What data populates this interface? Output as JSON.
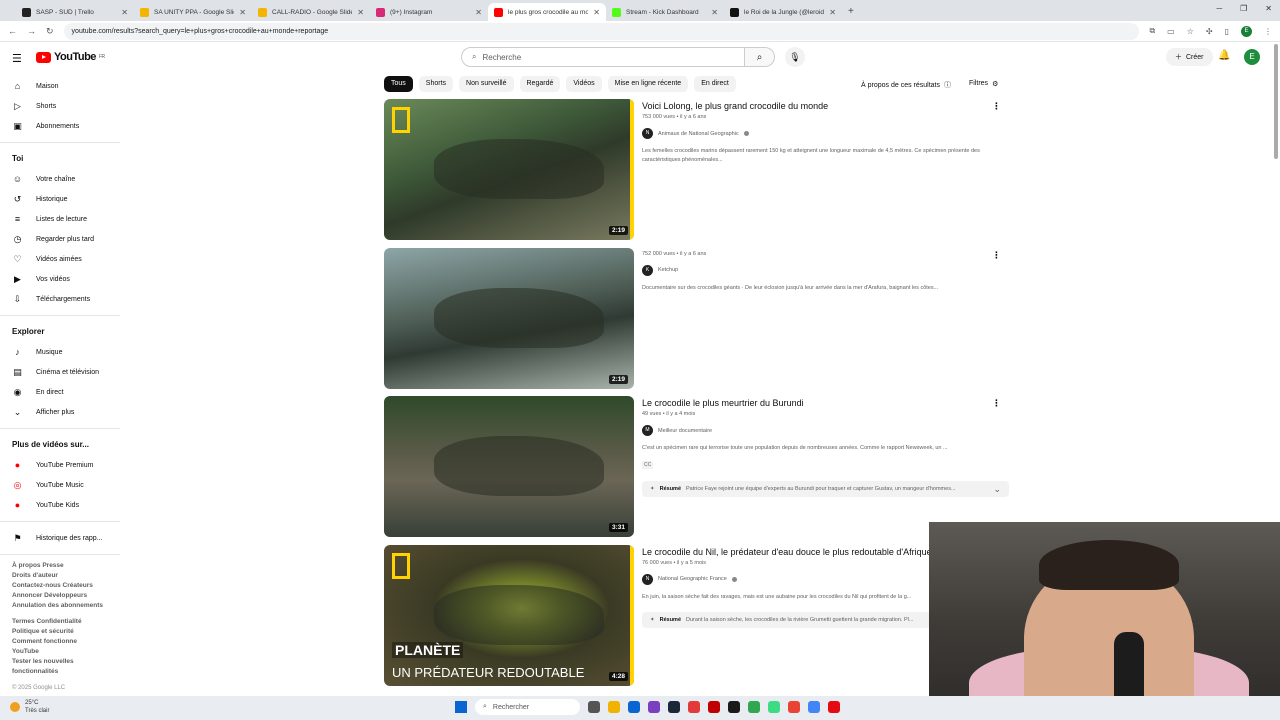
{
  "browser": {
    "tabs": [
      {
        "title": "SASP - SUD | Trello",
        "color": "#222222",
        "active": false
      },
      {
        "title": "SA UNITY PPA - Google Slides",
        "color": "#f4b400",
        "active": false
      },
      {
        "title": "CALL-RADIO - Google Slides",
        "color": "#f4b400",
        "active": false
      },
      {
        "title": "(9+) Instagram",
        "color": "#d62976",
        "active": false
      },
      {
        "title": "le plus gros crocodile au monde",
        "color": "#ff0000",
        "active": true
      },
      {
        "title": "Stream - Kick Dashboard",
        "color": "#53fc18",
        "active": false
      },
      {
        "title": "le Roi de la Jungle (@leroidelaj",
        "color": "#111111",
        "active": false
      }
    ],
    "url": "youtube.com/results?search_query=le+plus+gros+crocodile+au+monde+reportage"
  },
  "header": {
    "logo_text": "YouTube",
    "logo_sup": "FR",
    "search_placeholder": "Recherche",
    "create_label": "Créer",
    "avatar_letter": "E"
  },
  "sidebar": {
    "main": [
      {
        "label": "Maison",
        "icon": "⌂"
      },
      {
        "label": "Shorts",
        "icon": "▷"
      },
      {
        "label": "Abonnements",
        "icon": "▣"
      }
    ],
    "you_header": "Toi",
    "you": [
      {
        "label": "Votre chaîne",
        "icon": "☺"
      },
      {
        "label": "Historique",
        "icon": "↺"
      },
      {
        "label": "Listes de lecture",
        "icon": "≡"
      },
      {
        "label": "Regarder plus tard",
        "icon": "◷"
      },
      {
        "label": "Vidéos aimées",
        "icon": "♡"
      },
      {
        "label": "Vos vidéos",
        "icon": "▶"
      },
      {
        "label": "Téléchargements",
        "icon": "⇩"
      }
    ],
    "explore_header": "Explorer",
    "explore": [
      {
        "label": "Musique",
        "icon": "♪"
      },
      {
        "label": "Cinéma et télévision",
        "icon": "▤"
      },
      {
        "label": "En direct",
        "icon": "◉"
      },
      {
        "label": "Afficher plus",
        "icon": "⌄"
      }
    ],
    "more_header": "Plus de vidéos sur...",
    "more": [
      {
        "label": "YouTube Premium",
        "icon": "●"
      },
      {
        "label": "YouTube Music",
        "icon": "◎"
      },
      {
        "label": "YouTube Kids",
        "icon": "●"
      }
    ],
    "report": {
      "label": "Historique des rapp...",
      "icon": "⚑"
    },
    "footer1": "À propos  Presse\nDroits d'auteur\nContactez-nous  Créateurs\nAnnoncer  Développeurs\nAnnulation des abonnements",
    "footer2": "Termes  Confidentialité\nPolitique et sécurité\nComment fonctionne\nYouTube\nTester les nouvelles\nfonctionnalités",
    "copyright": "© 2025 Google LLC"
  },
  "chips": [
    "Tous",
    "Shorts",
    "Non surveillé",
    "Regardé",
    "Vidéos",
    "Mise en ligne récente",
    "En direct"
  ],
  "about_label": "À propos de ces résultats",
  "filters_label": "Filtres",
  "results": [
    {
      "title": "Voici Lolong, le plus grand crocodile du monde",
      "meta": "753 000 vues • il y a 6 ans",
      "channel": "Animaux de National Geographic",
      "channel_initial": "N",
      "desc": "Les femelles crocodiles marins dépassent rarement 150 kg et atteignent une longueur maximale de 4,5 mètres. Ce spécimen présente des caractéristiques phénoménales...",
      "duration": "2:19",
      "thumb": "t1"
    },
    {
      "title": "",
      "meta": "752 000 vues • il y a 6 ans",
      "channel": "Ketchup",
      "channel_initial": "K",
      "desc": "Documentaire sur des crocodiles géants · De leur éclosion jusqu'à leur arrivée dans la mer d'Arafura, baignant les côtes...",
      "duration": "2:19",
      "thumb": "t2"
    },
    {
      "title": "Le crocodile le plus meurtrier du Burundi",
      "meta": "49 vues • il y a 4 mois",
      "channel": "Meilleur documentaire",
      "channel_initial": "M",
      "desc": "C'est un spécimen rare qui terrorise toute une population depuis de nombreuses années. Comme le rapport Newsweek, un ...",
      "cc": "CC",
      "resume_label": "Résumé",
      "resume": "Patrice Faye rejoint une équipe d'experts au Burundi pour traquer et capturer Gustav, un mangeur d'hommes...",
      "duration": "3:31",
      "thumb": "t3"
    },
    {
      "title": "Le crocodile du Nil, le prédateur d'eau douce le plus redoutable d'Afrique",
      "meta": "76 000 vues • il y a 5 mois",
      "channel": "National Geographic France",
      "channel_initial": "N",
      "desc": "En juin, la saison sèche fait des ravages, mais est une aubaine pour les crocodiles du Nil qui profitent de la g...",
      "resume_label": "Résumé",
      "resume": "Durant la saison sèche, les crocodiles de la rivière Grumetti guettent la grande migration. Pl...",
      "duration": "4:28",
      "thumb": "t4",
      "overlay1": "PLANÈTE",
      "overlay2": "UN PRÉDATEUR REDOUTABLE"
    }
  ],
  "taskbar": {
    "temp": "25°C",
    "weather": "Très clair",
    "search_placeholder": "Rechercher",
    "apps": [
      "#555555",
      "#f0b400",
      "#0a64d2",
      "#7b3fbf",
      "#1b2838",
      "#e23a3a",
      "#c00000",
      "#1a1a1a",
      "#2fa84f",
      "#3ddc84",
      "#ea4335",
      "#4285f4",
      "#e50914"
    ]
  }
}
